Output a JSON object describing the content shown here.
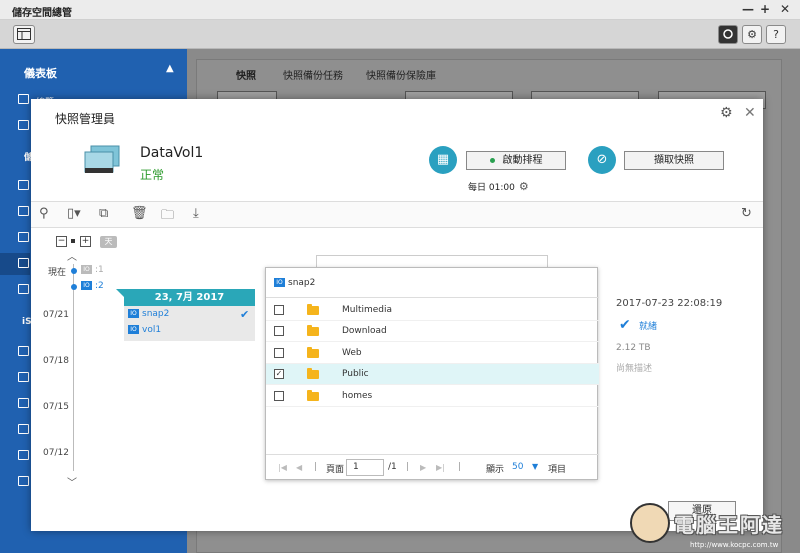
{
  "window": {
    "title": "儲存空間總管",
    "minimize": "—",
    "maximize": "+",
    "close": "✕"
  },
  "toolbar": {
    "help": "?",
    "settings": "⚙"
  },
  "sidebar": {
    "header": "儀表板",
    "labels": [
      "總覽",
      "儲",
      "iS"
    ]
  },
  "background": {
    "tabs": [
      "快照",
      "快照備份任務",
      "快照備份保險庫"
    ]
  },
  "modal": {
    "title": "快照管理員",
    "volume_name": "DataVol1",
    "volume_status": "正常",
    "schedule_button": "啟動排程",
    "schedule_text": "每日 01:00",
    "take_snapshot_button": "擷取快照",
    "close_button": "還原",
    "day_label": "天"
  },
  "timeline": {
    "now_label": "現在",
    "snap_labels": [
      ":1",
      ":2"
    ],
    "dates": [
      "07/21",
      "07/18",
      "07/15",
      "07/12"
    ],
    "card_date": "23, 7月 2017",
    "card_items": [
      "snap2",
      "vol1"
    ]
  },
  "popup": {
    "header": "snap2",
    "folders": [
      {
        "name": "Multimedia",
        "checked": false
      },
      {
        "name": "Download",
        "checked": false
      },
      {
        "name": "Web",
        "checked": false
      },
      {
        "name": "Public",
        "checked": true
      },
      {
        "name": "homes",
        "checked": false
      }
    ],
    "pager": {
      "page_label": "頁面",
      "page_value": "1",
      "page_total": "/1",
      "show_label": "顯示",
      "show_value": "50",
      "items_label": "項目"
    }
  },
  "details": {
    "timestamp": "2017-07-23 22:08:19",
    "status": "就緒",
    "size": "2.12 TB",
    "description": "尚無描述"
  },
  "watermark": {
    "text": "電腦王阿達",
    "url": "http://www.kocpc.com.tw"
  }
}
